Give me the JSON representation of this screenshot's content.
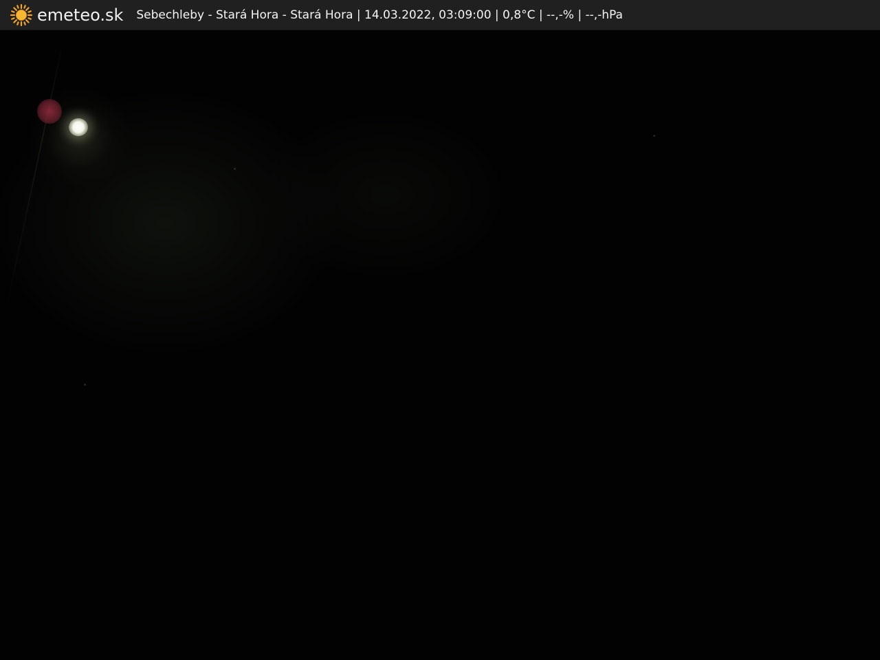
{
  "header": {
    "brand": "emeteo.sk",
    "caption": "Sebechleby - Stará Hora - Stará Hora | 14.03.2022, 03:09:00 | 0,8°C | --,-% | --,-hPa",
    "logo_icon": "sun-icon",
    "logo_color": "#f5a623",
    "bar_color": "#202020"
  },
  "scene": {
    "icons": [
      "moon-light",
      "lens-flare"
    ]
  }
}
